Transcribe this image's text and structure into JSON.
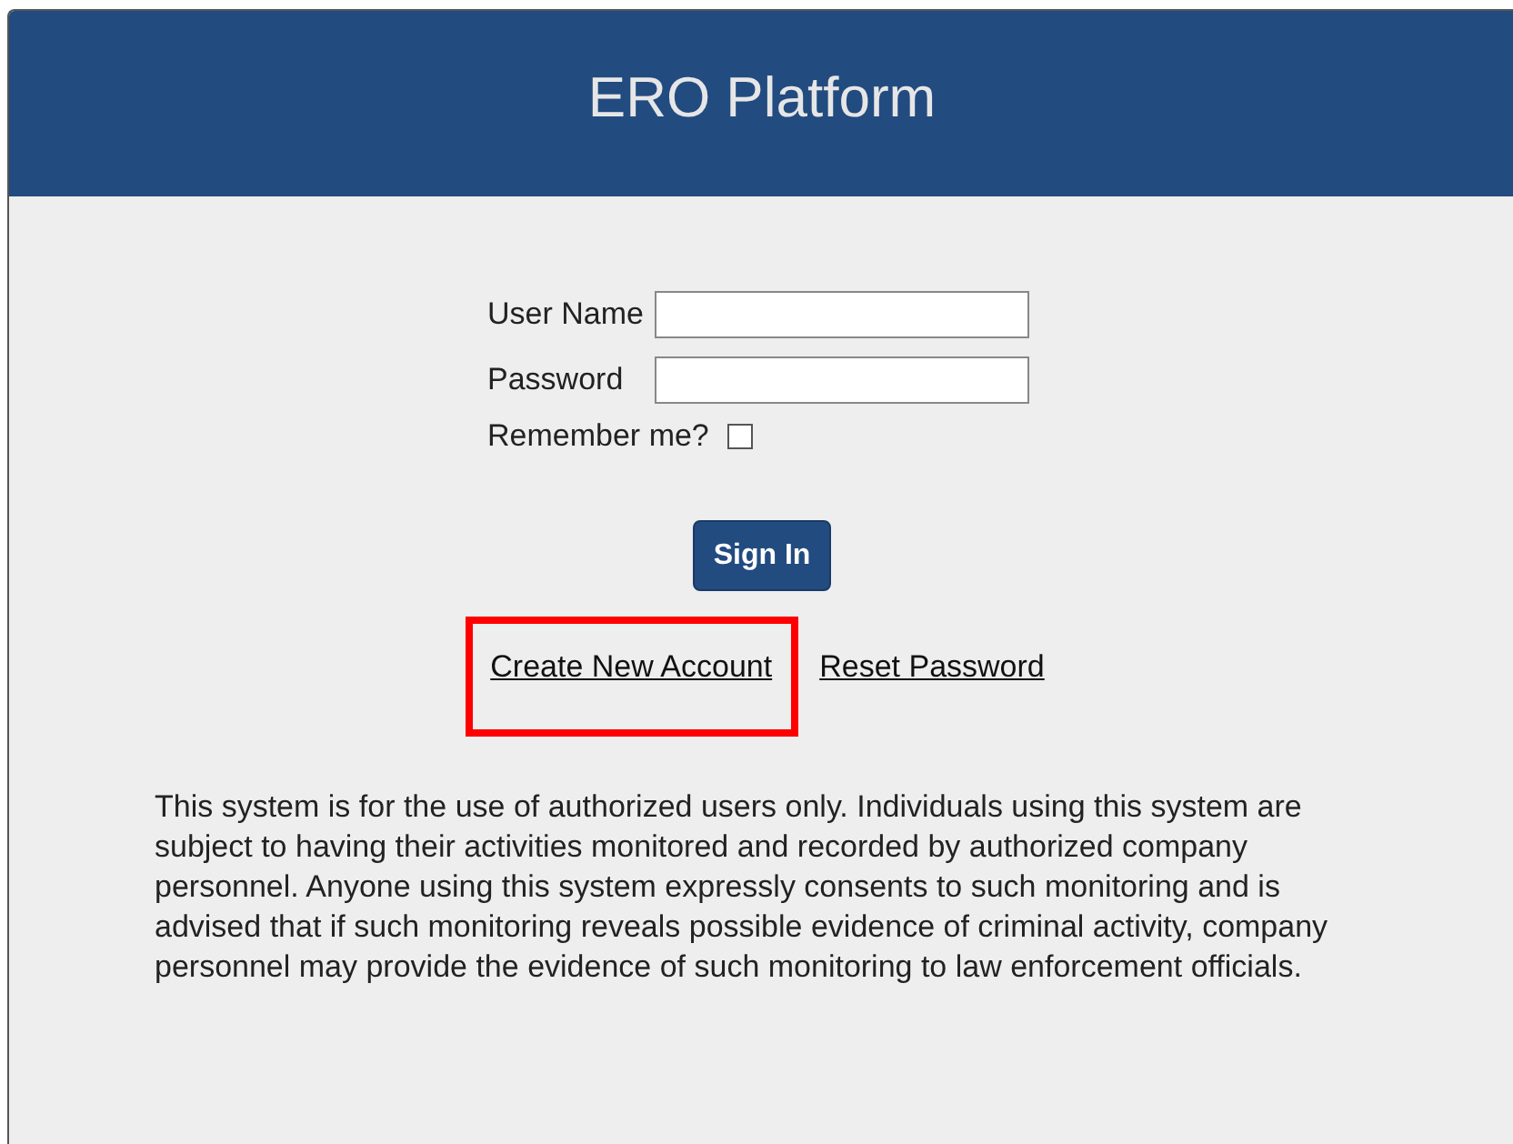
{
  "header": {
    "title": "ERO Platform"
  },
  "form": {
    "fields": [
      {
        "label": "User Name"
      },
      {
        "label": "Password"
      }
    ],
    "remember": {
      "label": "Remember me?",
      "checked": false
    },
    "submit": "Sign In"
  },
  "links": [
    {
      "label": "Create New Account",
      "highlighted": true
    },
    {
      "label": "Reset Password",
      "highlighted": false
    }
  ],
  "notice": "This system is for the use of authorized users only. Individuals using this system are subject to having their activities monitored and recorded by authorized company personnel. Anyone using this system expressly consents to such monitoring and is advised that if such monitoring reveals possible evidence of criminal activity, company personnel may provide the evidence of such monitoring to law enforcement officials."
}
